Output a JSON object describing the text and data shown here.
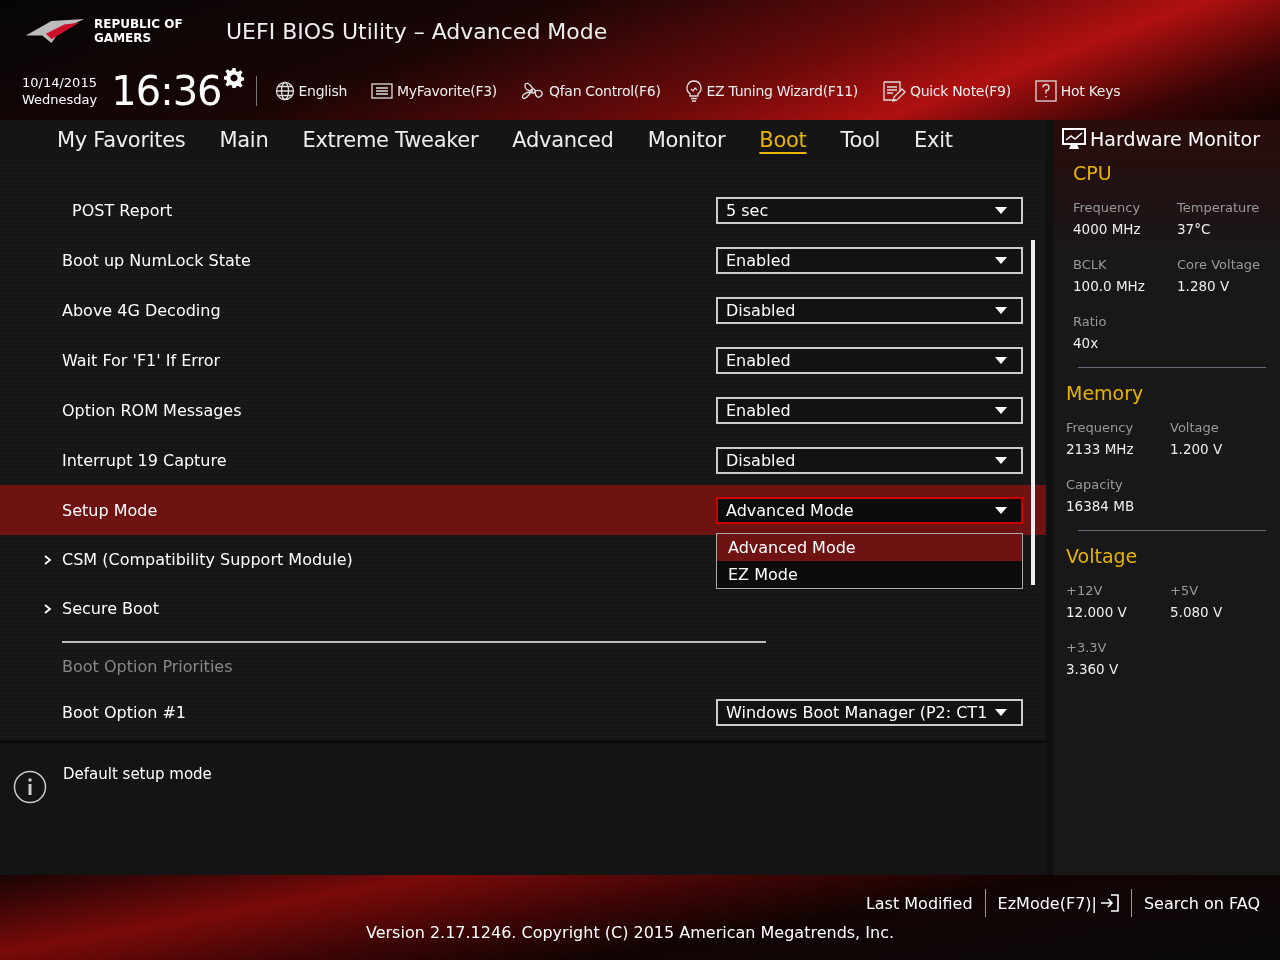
{
  "header": {
    "logo_line1": "REPUBLIC OF",
    "logo_line2": "GAMERS",
    "title": "UEFI BIOS Utility – Advanced Mode"
  },
  "toolbar": {
    "date": "10/14/2015",
    "day": "Wednesday",
    "time": "16:36",
    "items": [
      {
        "label": "English"
      },
      {
        "label": "MyFavorite(F3)"
      },
      {
        "label": "Qfan Control(F6)"
      },
      {
        "label": "EZ Tuning Wizard(F11)"
      },
      {
        "label": "Quick Note(F9)"
      },
      {
        "label": "Hot Keys"
      }
    ]
  },
  "tabs": [
    {
      "label": "My Favorites",
      "selected": false
    },
    {
      "label": "Main",
      "selected": false
    },
    {
      "label": "Extreme Tweaker",
      "selected": false
    },
    {
      "label": "Advanced",
      "selected": false
    },
    {
      "label": "Monitor",
      "selected": false
    },
    {
      "label": "Boot",
      "selected": true
    },
    {
      "label": "Tool",
      "selected": false
    },
    {
      "label": "Exit",
      "selected": false
    }
  ],
  "settings": [
    {
      "kind": "option",
      "label": "POST Report",
      "value": "5 sec",
      "selected": false
    },
    {
      "kind": "option",
      "label": "Boot up NumLock State",
      "value": "Enabled",
      "selected": false
    },
    {
      "kind": "option",
      "label": "Above 4G Decoding",
      "value": "Disabled",
      "selected": false
    },
    {
      "kind": "option",
      "label": "Wait For 'F1' If Error",
      "value": "Enabled",
      "selected": false
    },
    {
      "kind": "option",
      "label": "Option ROM Messages",
      "value": "Enabled",
      "selected": false
    },
    {
      "kind": "option",
      "label": "Interrupt 19 Capture",
      "value": "Disabled",
      "selected": false
    },
    {
      "kind": "option",
      "label": "Setup Mode",
      "value": "Advanced Mode",
      "selected": true,
      "expanded": true,
      "options": [
        {
          "label": "Advanced Mode",
          "selected": true
        },
        {
          "label": "EZ Mode",
          "selected": false
        }
      ]
    },
    {
      "kind": "submenu",
      "label": "CSM (Compatibility Support Module)",
      "selected": false
    },
    {
      "kind": "submenu",
      "label": "Secure Boot",
      "selected": false
    },
    {
      "kind": "divider"
    },
    {
      "kind": "heading",
      "label": "Boot Option Priorities"
    },
    {
      "kind": "option",
      "label": "Boot Option #1",
      "value": "Windows Boot Manager (P2: CT1",
      "selected": false
    }
  ],
  "help": {
    "text": "Default setup mode"
  },
  "hardware_monitor": {
    "title": "Hardware Monitor",
    "sections": [
      {
        "title": "CPU",
        "items": [
          {
            "label": "Frequency",
            "value": "4000 MHz"
          },
          {
            "label": "Temperature",
            "value": "37°C"
          },
          {
            "label": "BCLK",
            "value": "100.0 MHz"
          },
          {
            "label": "Core Voltage",
            "value": "1.280 V"
          },
          {
            "label": "Ratio",
            "value": "40x"
          }
        ]
      },
      {
        "title": "Memory",
        "items": [
          {
            "label": "Frequency",
            "value": "2133 MHz"
          },
          {
            "label": "Voltage",
            "value": "1.200 V"
          },
          {
            "label": "Capacity",
            "value": "16384 MB"
          }
        ]
      },
      {
        "title": "Voltage",
        "items": [
          {
            "label": "+12V",
            "value": "12.000 V"
          },
          {
            "label": "+5V",
            "value": "5.080 V"
          },
          {
            "label": "+3.3V",
            "value": "3.360 V"
          }
        ]
      }
    ]
  },
  "footer": {
    "buttons": [
      {
        "label": "Last Modified"
      },
      {
        "label": "EzMode(F7)|"
      },
      {
        "label": "Search on FAQ"
      }
    ],
    "version": "Version 2.17.1246. Copyright (C) 2015 American Megatrends, Inc."
  }
}
